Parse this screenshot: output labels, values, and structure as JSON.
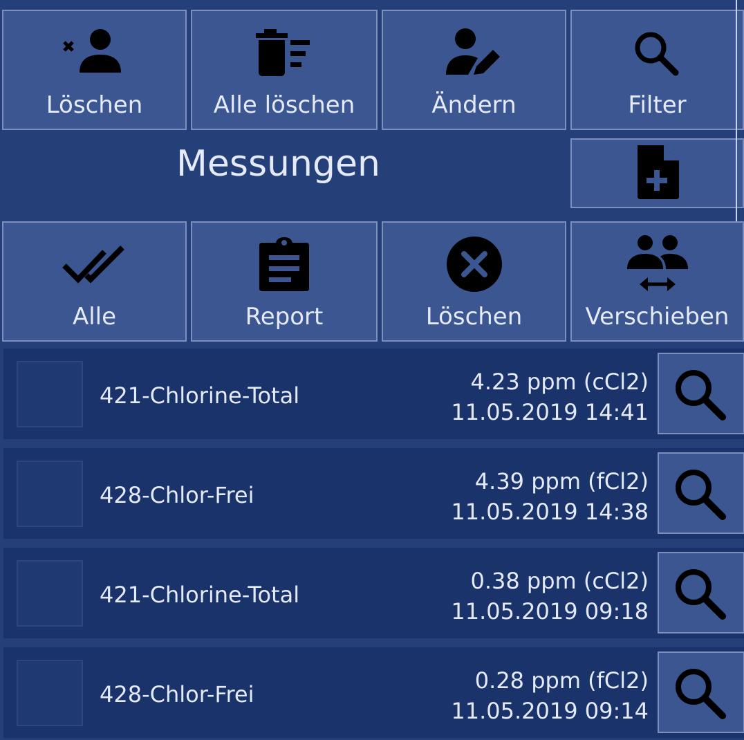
{
  "toolbar_top": [
    {
      "label": "Löschen",
      "icon": "delete-user-icon"
    },
    {
      "label": "Alle löschen",
      "icon": "delete-all-icon"
    },
    {
      "label": "Ändern",
      "icon": "edit-user-icon"
    },
    {
      "label": "Filter",
      "icon": "search-icon"
    }
  ],
  "title": "Messungen",
  "new_button": {
    "icon": "new-document-icon"
  },
  "toolbar_bottom": [
    {
      "label": "Alle",
      "icon": "double-check-icon"
    },
    {
      "label": "Report",
      "icon": "clipboard-icon"
    },
    {
      "label": "Löschen",
      "icon": "cancel-circle-icon"
    },
    {
      "label": "Verschieben",
      "icon": "move-users-icon"
    }
  ],
  "measurements": [
    {
      "name": "421-Chlorine-Total",
      "value": "4.23 ppm (cCl2)",
      "timestamp": "11.05.2019 14:41"
    },
    {
      "name": "428-Chlor-Frei",
      "value": "4.39 ppm (fCl2)",
      "timestamp": "11.05.2019 14:38"
    },
    {
      "name": "421-Chlorine-Total",
      "value": "0.38 ppm (cCl2)",
      "timestamp": "11.05.2019 09:18"
    },
    {
      "name": "428-Chlor-Frei",
      "value": "0.28 ppm (fCl2)",
      "timestamp": "11.05.2019 09:14"
    }
  ],
  "colors": {
    "background": "#253f78",
    "tile": "#3b5691",
    "row": "#1a336b",
    "icon": "#000000"
  }
}
